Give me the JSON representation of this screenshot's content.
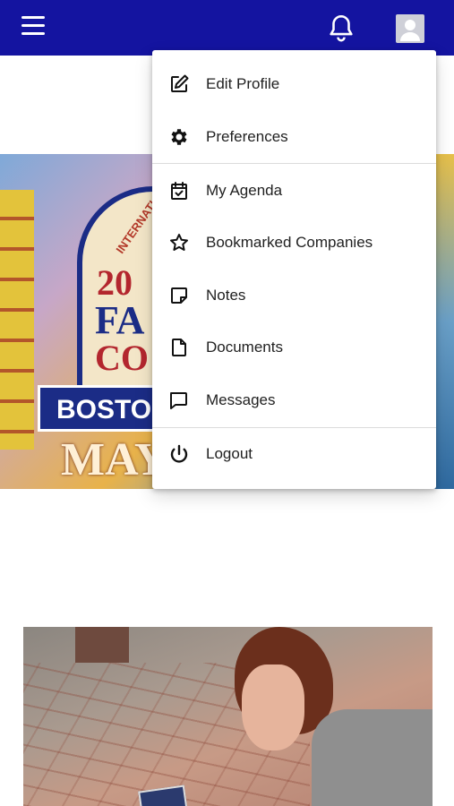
{
  "topbar": {
    "bg_color": "#1414a0",
    "menu_icon": "hamburger-icon",
    "notifications_icon": "bell-icon",
    "account_icon": "user-avatar-icon"
  },
  "banner": {
    "intl_text": "INTERNATI",
    "year_text": "20",
    "line1_text": "FA",
    "line2_text": "CO",
    "city_text": "BOSTON",
    "month_text": "MAY"
  },
  "menu": {
    "items": [
      {
        "label": "Edit Profile",
        "icon": "edit-icon"
      },
      {
        "label": "Preferences",
        "icon": "gear-icon"
      },
      {
        "label": "My Agenda",
        "icon": "calendar-check-icon"
      },
      {
        "label": "Bookmarked Companies",
        "icon": "star-icon"
      },
      {
        "label": "Notes",
        "icon": "note-icon"
      },
      {
        "label": "Documents",
        "icon": "document-icon"
      },
      {
        "label": "Messages",
        "icon": "message-icon"
      },
      {
        "label": "Logout",
        "icon": "power-icon"
      }
    ]
  }
}
